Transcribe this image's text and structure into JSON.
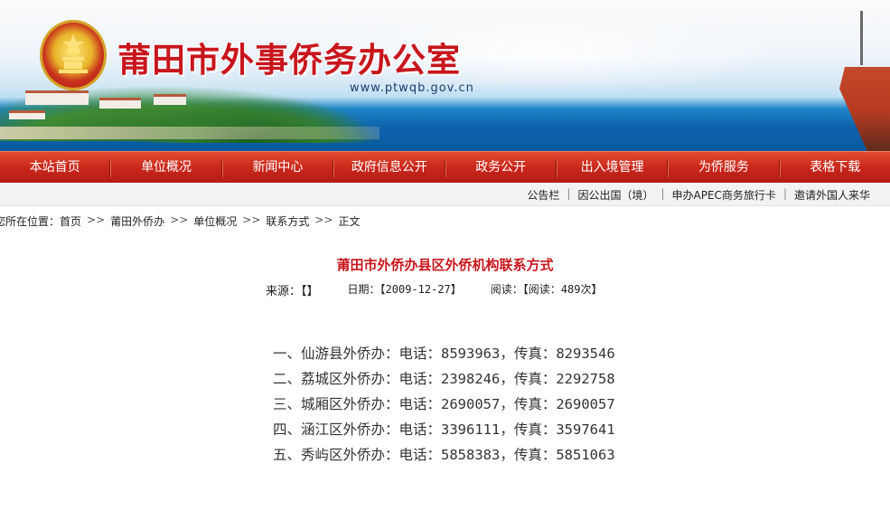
{
  "header": {
    "site_title": "莆田市外事侨务办公室",
    "site_url": "www.ptwqb.gov.cn",
    "accent_color": "#c8161d"
  },
  "nav": {
    "items": [
      {
        "label": "本站首页"
      },
      {
        "label": "单位概况"
      },
      {
        "label": "新闻中心"
      },
      {
        "label": "政府信息公开"
      },
      {
        "label": "政务公开"
      },
      {
        "label": "出入境管理"
      },
      {
        "label": "为侨服务"
      },
      {
        "label": "表格下载"
      }
    ]
  },
  "sublinks": {
    "items": [
      {
        "label": "公告栏"
      },
      {
        "label": "因公出国（境）"
      },
      {
        "label": "申办APEC商务旅行卡"
      },
      {
        "label": "邀请外国人来华"
      }
    ],
    "separator": "|"
  },
  "breadcrumb": {
    "prefix": "您所在位置：",
    "items": [
      {
        "label": "首页"
      },
      {
        "label": "莆田外侨办"
      },
      {
        "label": "单位概况"
      },
      {
        "label": "联系方式"
      },
      {
        "label": "正文"
      }
    ],
    "separator": ">>"
  },
  "article": {
    "title": "莆田市外侨办县区外侨机构联系方式",
    "source_label": "来源：【】",
    "date_label": "日期：【2009-12-27】",
    "reads_label": "阅读：【阅读：489次】",
    "lines": [
      "一、仙游县外侨办：电话：8593963，传真：8293546",
      "二、荔城区外侨办：电话：2398246，传真：2292758",
      "三、城厢区外侨办：电话：2690057，传真：2690057",
      "四、涵江区外侨办：电话：3396111，传真：3597641",
      "五、秀屿区外侨办：电话：5858383，传真：5851063"
    ]
  }
}
